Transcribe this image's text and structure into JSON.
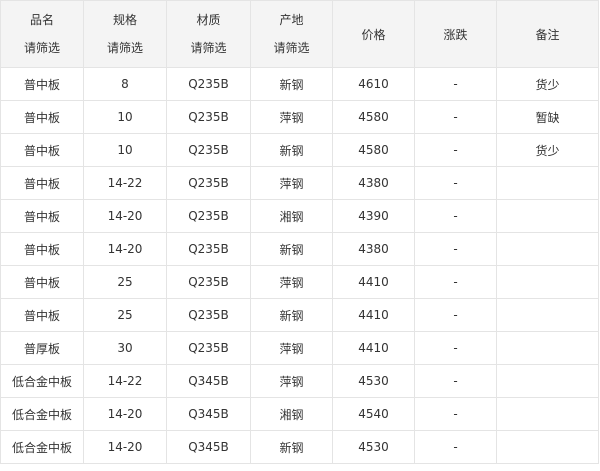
{
  "table": {
    "headers": {
      "name": "品名",
      "spec": "规格",
      "material": "材质",
      "origin": "产地",
      "price": "价格",
      "change": "涨跌",
      "remark": "备注",
      "filter_label": "请筛选"
    },
    "rows": [
      {
        "name": "普中板",
        "spec": "8",
        "material": "Q235B",
        "origin": "新钢",
        "price": "4610",
        "change": "-",
        "remark": "货少"
      },
      {
        "name": "普中板",
        "spec": "10",
        "material": "Q235B",
        "origin": "萍钢",
        "price": "4580",
        "change": "-",
        "remark": "暂缺"
      },
      {
        "name": "普中板",
        "spec": "10",
        "material": "Q235B",
        "origin": "新钢",
        "price": "4580",
        "change": "-",
        "remark": "货少"
      },
      {
        "name": "普中板",
        "spec": "14-22",
        "material": "Q235B",
        "origin": "萍钢",
        "price": "4380",
        "change": "-",
        "remark": ""
      },
      {
        "name": "普中板",
        "spec": "14-20",
        "material": "Q235B",
        "origin": "湘钢",
        "price": "4390",
        "change": "-",
        "remark": ""
      },
      {
        "name": "普中板",
        "spec": "14-20",
        "material": "Q235B",
        "origin": "新钢",
        "price": "4380",
        "change": "-",
        "remark": ""
      },
      {
        "name": "普中板",
        "spec": "25",
        "material": "Q235B",
        "origin": "萍钢",
        "price": "4410",
        "change": "-",
        "remark": ""
      },
      {
        "name": "普中板",
        "spec": "25",
        "material": "Q235B",
        "origin": "新钢",
        "price": "4410",
        "change": "-",
        "remark": ""
      },
      {
        "name": "普厚板",
        "spec": "30",
        "material": "Q235B",
        "origin": "萍钢",
        "price": "4410",
        "change": "-",
        "remark": ""
      },
      {
        "name": "低合金中板",
        "spec": "14-22",
        "material": "Q345B",
        "origin": "萍钢",
        "price": "4530",
        "change": "-",
        "remark": ""
      },
      {
        "name": "低合金中板",
        "spec": "14-20",
        "material": "Q345B",
        "origin": "湘钢",
        "price": "4540",
        "change": "-",
        "remark": ""
      },
      {
        "name": "低合金中板",
        "spec": "14-20",
        "material": "Q345B",
        "origin": "新钢",
        "price": "4530",
        "change": "-",
        "remark": ""
      }
    ]
  },
  "colors": {
    "link": "#1a3fd6",
    "header_bg": "#f4f4f4",
    "border": "#e4e4e4"
  }
}
